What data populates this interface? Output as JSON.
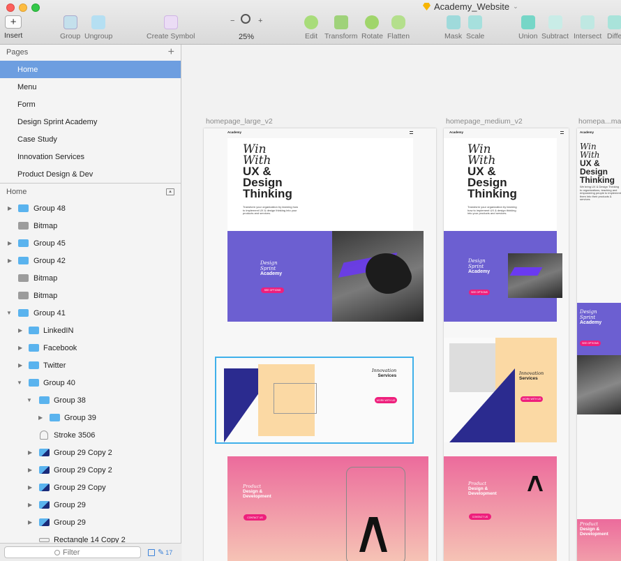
{
  "app": {
    "doc_title": "Academy_Website"
  },
  "toolbar": {
    "insert": "Insert",
    "group": "Group",
    "ungroup": "Ungroup",
    "create_symbol": "Create Symbol",
    "zoom_minus": "−",
    "zoom_plus": "+",
    "zoom": "25%",
    "edit": "Edit",
    "transform": "Transform",
    "rotate": "Rotate",
    "flatten": "Flatten",
    "mask": "Mask",
    "scale": "Scale",
    "union": "Union",
    "subtract": "Subtract",
    "intersect": "Intersect",
    "difference": "Diffe"
  },
  "pages": {
    "header": "Pages",
    "items": [
      "Home",
      "Menu",
      "Form",
      "Design Sprint Academy",
      "Case Study",
      "Innovation Services",
      "Product Design & Dev"
    ]
  },
  "layers": {
    "header": "Home",
    "items": [
      "Group 48",
      "Bitmap",
      "Group 45",
      "Group 42",
      "Bitmap",
      "Bitmap",
      "Group 41",
      "LinkedIN",
      "Facebook",
      "Twitter",
      "Group 40",
      "Group 38",
      "Group 39",
      "Stroke 3506",
      "Group 29 Copy 2",
      "Group 29 Copy 2",
      "Group 29 Copy",
      "Group 29",
      "Group 29",
      "Rectangle 14 Copy 2"
    ]
  },
  "filter": {
    "placeholder": "Filter",
    "count": "17"
  },
  "artboards": {
    "large": "homepage_large_v2",
    "medium": "homepage_medium_v2",
    "small": "homepa...ma"
  },
  "site": {
    "brand": "Academy",
    "h1a": "Win",
    "h1b": "With",
    "h1c": "UX &",
    "h1d": "Design",
    "h1e": "Thinking",
    "h1f": "Design Thinking",
    "intro": "Transform your organization by learning how to implement UX & design thinking into your products and services.",
    "s1a": "Design",
    "s1b": "Sprint",
    "s1c": "Academy",
    "btn1": "SEE OPTIONS",
    "s2a": "Innovation",
    "s2b": "Services",
    "btn2": "WORK WITH US",
    "s3a": "Product",
    "s3b": "Design &",
    "s3c": "Development",
    "btn3": "CONTACT US",
    "small_intro": "We bring UX & Design Thinking to organizations, teaching and empowering people to implement them into their products & services"
  },
  "colors": {
    "selection": "#6d9ee0",
    "purple": "#6c5fd1",
    "pink": "#ee1f7c",
    "peach": "#fbd9a4",
    "navy": "#2b2b8f"
  }
}
